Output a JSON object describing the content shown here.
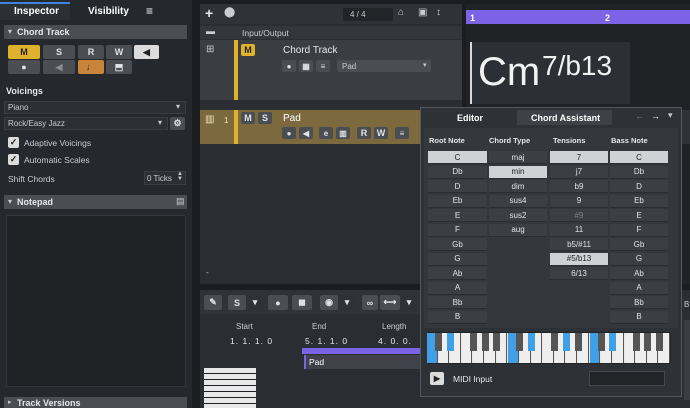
{
  "inspector": {
    "tab": "Inspector",
    "tab2": "Visibility",
    "menu": "≡",
    "section": "Chord Track",
    "m": "M",
    "s": "S",
    "r": "R",
    "w": "W",
    "voicings": "Voicings",
    "voicing": "Piano",
    "style": "Rock/Easy Jazz",
    "adaptive": "Adaptive Voicings",
    "auto": "Automatic Scales",
    "shift": "Shift Chords",
    "ticks": "0 Ticks",
    "notepad": "Notepad",
    "track_versions": "Track Versions"
  },
  "toolbar": {
    "counter": "4 / 4"
  },
  "tracks": {
    "folder": "Input/Output",
    "chord": {
      "name": "Chord Track",
      "m": "M",
      "output": "Pad"
    },
    "pad": {
      "num": "1",
      "m": "M",
      "s": "S",
      "name": "Pad",
      "r": "R",
      "w": "W"
    }
  },
  "arrange": {
    "bar1": "1",
    "bar2": "2",
    "chord": "Cm",
    "ext": "7/b13"
  },
  "editor_tabs": {
    "tab1": "Editor",
    "tab2": "Chord Assistant"
  },
  "editor": {
    "h_root": "Root Note",
    "h_type": "Chord Type",
    "h_tens": "Tensions",
    "h_bass": "Bass Note",
    "root": [
      "C",
      "Db",
      "D",
      "Eb",
      "E",
      "F",
      "Gb",
      "G",
      "Ab",
      "A",
      "Bb",
      "B"
    ],
    "types": [
      "maj",
      "min",
      "dim",
      "sus4",
      "sus2",
      "aug"
    ],
    "tensions": [
      "7",
      "j7",
      "b9",
      "9",
      "#9",
      "11",
      "b5/#11",
      "#5/b13",
      "6/13"
    ],
    "bass": [
      "C",
      "Db",
      "D",
      "Eb",
      "E",
      "F",
      "Gb",
      "G",
      "Ab",
      "A",
      "Bb",
      "B"
    ],
    "midi": "MIDI Input"
  },
  "lower": {
    "start": "Start",
    "end": "End",
    "length": "Length",
    "v_start": "1. 1. 1. 0",
    "v_end": "5. 1. 1. 0",
    "v_len": "4. 0. 0.",
    "part": "Pad"
  },
  "colors": {
    "accent": "#7b63e6",
    "yellow": "#e0b12a",
    "blue": "#3fa0e8"
  }
}
